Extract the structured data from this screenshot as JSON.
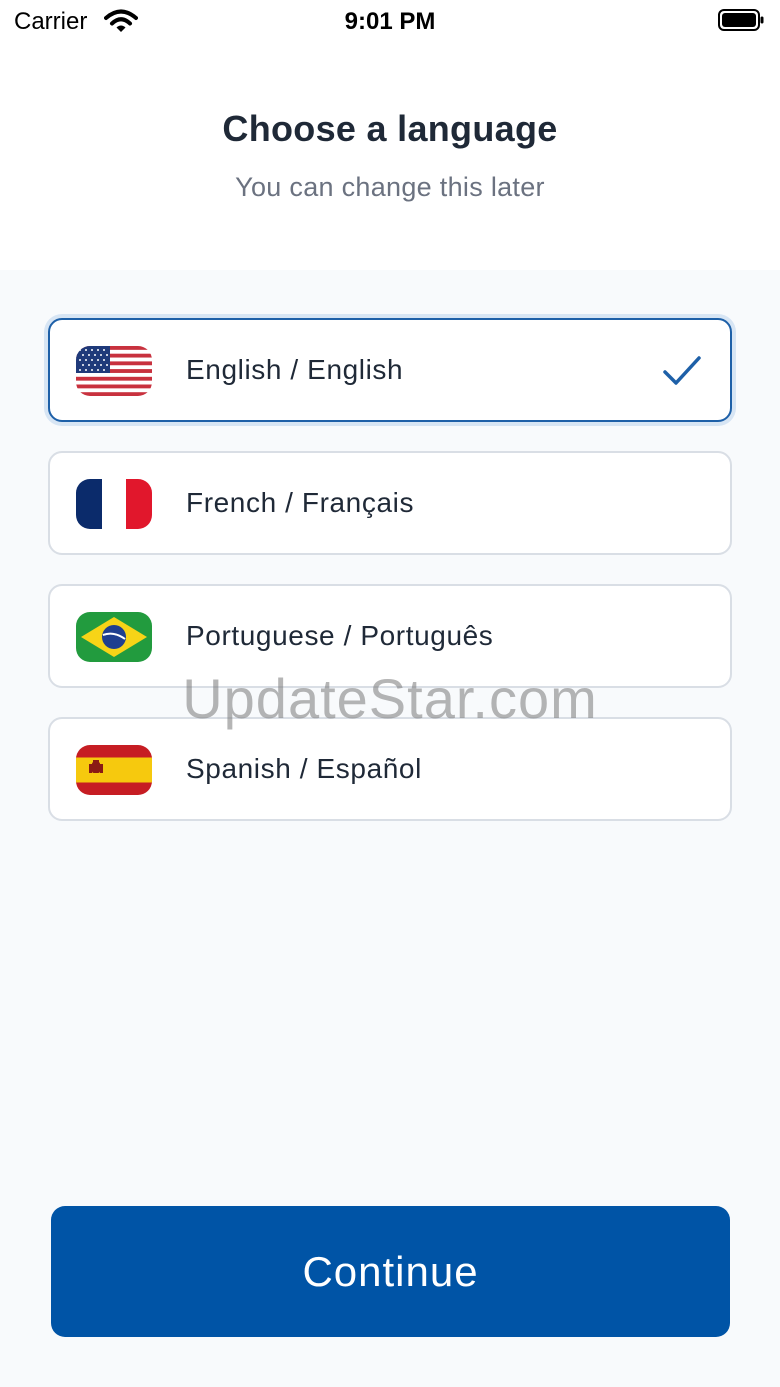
{
  "status_bar": {
    "carrier": "Carrier",
    "time": "9:01 PM"
  },
  "header": {
    "title": "Choose a language",
    "subtitle": "You can change this later"
  },
  "languages": [
    {
      "label": "English / English",
      "flag": "us-flag-icon",
      "selected": true
    },
    {
      "label": "French / Français",
      "flag": "france-flag-icon",
      "selected": false
    },
    {
      "label": "Portuguese / Português",
      "flag": "brazil-flag-icon",
      "selected": false
    },
    {
      "label": "Spanish / Español",
      "flag": "spain-flag-icon",
      "selected": false
    }
  ],
  "watermark": "UpdateStar.com",
  "continue_label": "Continue",
  "colors": {
    "primary": "#0054a6",
    "selected_border": "#1e60a8",
    "background": "#f8fafc"
  }
}
